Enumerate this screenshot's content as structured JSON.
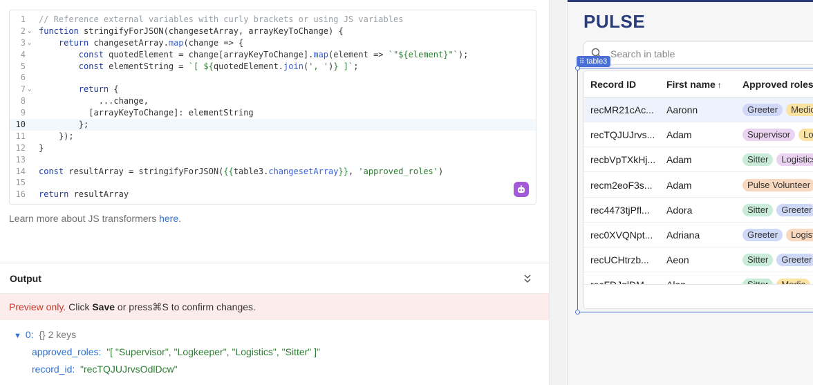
{
  "editor": {
    "lines": [
      {
        "n": "1",
        "fold": "",
        "html": "<span class=\"c-cm\">// Reference external variables with curly brackets or using JS variables</span>"
      },
      {
        "n": "2",
        "fold": "v",
        "html": "<span class=\"c-kw\">function</span> stringifyForJSON(changesetArray, arrayKeyToChange) {"
      },
      {
        "n": "3",
        "fold": "v",
        "html": "    <span class=\"c-kw\">return</span> changesetArray.<span class=\"c-call\">map</span>(change => {"
      },
      {
        "n": "4",
        "fold": "",
        "html": "        <span class=\"c-kw\">const</span> quotedElement = change[arrayKeyToChange].<span class=\"c-call\">map</span>(element => <span class=\"c-str\">`\"${element}\"`</span>);"
      },
      {
        "n": "5",
        "fold": "",
        "html": "        <span class=\"c-kw\">const</span> elementString = <span class=\"c-str\">`[ ${</span>quotedElement.<span class=\"c-call\">join</span>(<span class=\"c-str\">', '</span>)<span class=\"c-str\">} ]`</span>;"
      },
      {
        "n": "6",
        "fold": "",
        "html": ""
      },
      {
        "n": "7",
        "fold": "v",
        "html": "        <span class=\"c-kw\">return</span> {"
      },
      {
        "n": "8",
        "fold": "",
        "html": "            ...change,"
      },
      {
        "n": "9",
        "fold": "",
        "html": "          [arrayKeyToChange]: elementString"
      },
      {
        "n": "10",
        "fold": "",
        "html": "        };",
        "active": true
      },
      {
        "n": "11",
        "fold": "",
        "html": "    });"
      },
      {
        "n": "12",
        "fold": "",
        "html": "}"
      },
      {
        "n": "13",
        "fold": "",
        "html": ""
      },
      {
        "n": "14",
        "fold": "",
        "html": "<span class=\"c-kw\">const</span> resultArray = stringifyForJSON(<span class=\"c-brace\">{{</span>table3.<span class=\"c-call\">changesetArray</span><span class=\"c-brace\">}}</span>, <span class=\"c-str\">'approved_roles'</span>)"
      },
      {
        "n": "15",
        "fold": "",
        "html": ""
      },
      {
        "n": "16",
        "fold": "",
        "html": "<span class=\"c-kw\">return</span> resultArray"
      }
    ]
  },
  "learn": {
    "prefix": "Learn more about JS transformers ",
    "link": "here",
    "suffix": "."
  },
  "output": {
    "title": "Output",
    "preview_warn": "Preview only.",
    "preview_mid1": " Click ",
    "preview_save": "Save",
    "preview_mid2": " or press",
    "preview_shortcut": "⌘S",
    "preview_end": " to confirm changes.",
    "root_key": "0:",
    "root_meta": "{}  2 keys",
    "fields": [
      {
        "key": "approved_roles:",
        "value": "\"[ \"Supervisor\", \"Logkeeper\", \"Logistics\", \"Sitter\" ]\""
      },
      {
        "key": "record_id:",
        "value": "\"recTQJUJrvsOdlDcw\""
      }
    ]
  },
  "canvas": {
    "title": "PULSE",
    "search_placeholder": "Search in table",
    "component_tag": "table3",
    "columns": [
      "Record ID",
      "First name",
      "Approved roles"
    ],
    "sort_indicator": "↑",
    "rows": [
      {
        "id": "recMR21cAc...",
        "first": "Aaronn",
        "roles": [
          {
            "t": "Greeter",
            "c": "#cfd8f7"
          },
          {
            "t": "Medic",
            "c": "#fbe3a4"
          }
        ],
        "selected": true
      },
      {
        "id": "recTQJUJrvs...",
        "first": "Adam",
        "roles": [
          {
            "t": "Supervisor",
            "c": "#ead3f1"
          },
          {
            "t": "Logkeeper",
            "c": "#fbe3a4"
          }
        ]
      },
      {
        "id": "recbVpTXkHj...",
        "first": "Adam",
        "roles": [
          {
            "t": "Sitter",
            "c": "#c9ecd8"
          },
          {
            "t": "Logistics",
            "c": "#ead3f1"
          }
        ]
      },
      {
        "id": "recm2eoF3s...",
        "first": "Adam",
        "roles": [
          {
            "t": "Pulse Volunteer",
            "c": "#f8d9bf"
          }
        ]
      },
      {
        "id": "rec4473tjPfl...",
        "first": "Adora",
        "roles": [
          {
            "t": "Sitter",
            "c": "#c9ecd8"
          },
          {
            "t": "Greeter",
            "c": "#cfd8f7"
          }
        ]
      },
      {
        "id": "rec0XVQNpt...",
        "first": "Adriana",
        "roles": [
          {
            "t": "Greeter",
            "c": "#cfd8f7"
          },
          {
            "t": "Logistics",
            "c": "#f8d9bf"
          }
        ]
      },
      {
        "id": "recUCHtrzb...",
        "first": "Aeon",
        "roles": [
          {
            "t": "Sitter",
            "c": "#c9ecd8"
          },
          {
            "t": "Greeter",
            "c": "#cfd8f7"
          }
        ]
      },
      {
        "id": "recFDJqlDM...",
        "first": "Alan",
        "roles": [
          {
            "t": "Sitter",
            "c": "#c9ecd8"
          },
          {
            "t": "Medic",
            "c": "#fbe3a4"
          }
        ]
      }
    ]
  },
  "colors": {
    "accent": "#4a6fd6",
    "brand": "#2b3c7a",
    "bot": "#a25ad6",
    "preview_bg": "#fdecec"
  },
  "icons": {
    "bot": "bot-icon",
    "collapse": "chevrons-down-icon",
    "search": "search-icon",
    "grip": "grip-icon",
    "tree": "caret-down-icon"
  }
}
